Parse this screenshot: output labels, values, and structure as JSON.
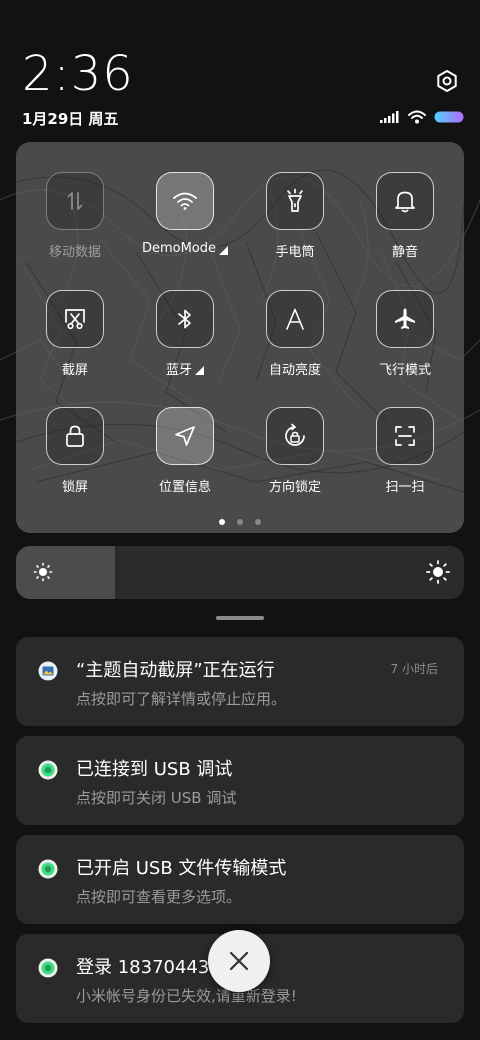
{
  "status": {
    "time": "2:36",
    "date": "1月29日 周五"
  },
  "quick_settings": {
    "tiles": [
      {
        "label": "移动数据",
        "icon": "mobile-data-icon",
        "state": "disabled"
      },
      {
        "label": "DemoMode",
        "icon": "wifi-icon",
        "state": "active",
        "expandable": true
      },
      {
        "label": "手电筒",
        "icon": "flashlight-icon",
        "state": "off"
      },
      {
        "label": "静音",
        "icon": "bell-icon",
        "state": "off"
      },
      {
        "label": "截屏",
        "icon": "screenshot-icon",
        "state": "off"
      },
      {
        "label": "蓝牙",
        "icon": "bluetooth-icon",
        "state": "off",
        "expandable": true
      },
      {
        "label": "自动亮度",
        "icon": "auto-brightness-icon",
        "state": "off"
      },
      {
        "label": "飞行模式",
        "icon": "airplane-icon",
        "state": "off"
      },
      {
        "label": "锁屏",
        "icon": "lock-icon",
        "state": "off"
      },
      {
        "label": "位置信息",
        "icon": "location-icon",
        "state": "active"
      },
      {
        "label": "方向锁定",
        "icon": "rotation-lock-icon",
        "state": "off"
      },
      {
        "label": "扫一扫",
        "icon": "scan-icon",
        "state": "off"
      }
    ],
    "page_index": 1,
    "page_count": 3
  },
  "brightness": {
    "level": 0.22
  },
  "notifications": [
    {
      "title": "“主题自动截屏”正在运行",
      "text": "点按即可了解详情或停止应用。",
      "time": "7 小时后",
      "icon": "theme-app-icon"
    },
    {
      "title": "已连接到 USB 调试",
      "text": "点按即可关闭 USB 调试",
      "time": "",
      "icon": "android-icon"
    },
    {
      "title": "已开启 USB 文件传输模式",
      "text": "点按即可查看更多选项。",
      "time": "",
      "icon": "android-icon"
    },
    {
      "title": "登录 18370443…错",
      "text": "小米帐号身份已失效,请重新登录!",
      "time": "",
      "icon": "android-icon"
    }
  ],
  "colors": {
    "background": "#121212",
    "panel": "#5f5f5f",
    "card": "#2a2a2a",
    "battery_gradient_start": "#4fd0ff",
    "battery_gradient_end": "#b36cff",
    "android_green": "#3ddc84"
  }
}
